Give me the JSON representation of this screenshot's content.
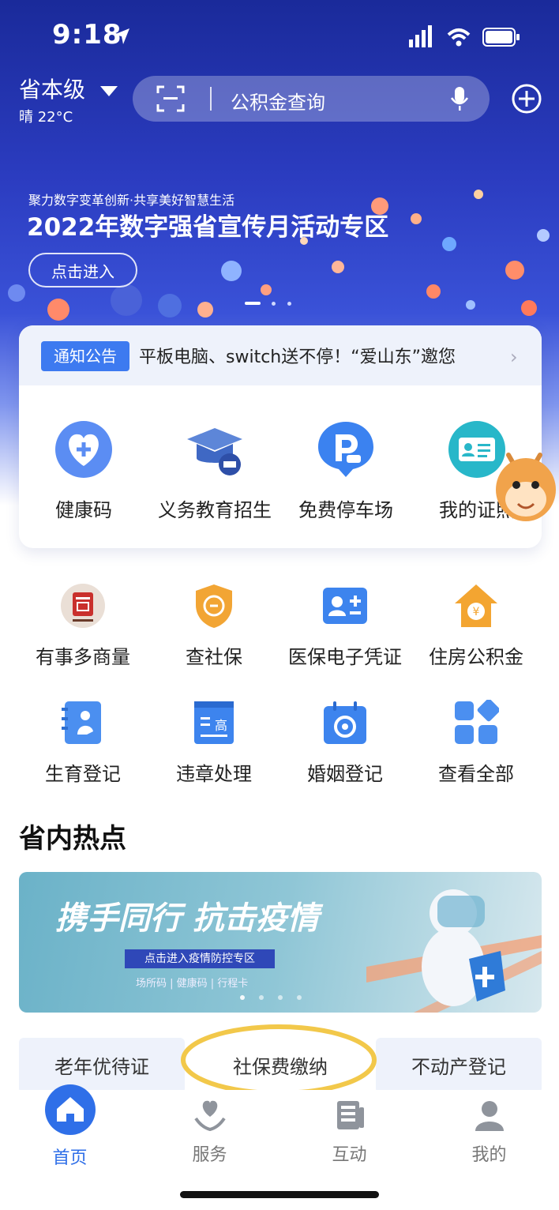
{
  "status_bar": {
    "time": "9:18"
  },
  "header": {
    "region": "省本级",
    "weather": "晴 22°C",
    "search_placeholder": "公积金查询"
  },
  "banner": {
    "subtitle": "聚力数字变革创新·共享美好智慧生活",
    "title": "2022年数字强省宣传月活动专区",
    "button": "点击进入"
  },
  "notice": {
    "tag": "通知公告",
    "text": "平板电脑、switch送不停！“爱山东”邀您"
  },
  "quick_items": [
    {
      "label": "健康码",
      "icon": "health-code-icon"
    },
    {
      "label": "义务教育招生",
      "icon": "education-cap-icon"
    },
    {
      "label": "免费停车场",
      "icon": "parking-icon"
    },
    {
      "label": "我的证照",
      "icon": "id-card-icon"
    }
  ],
  "services": [
    {
      "label": "有事多商量",
      "icon": "consult-seal-icon"
    },
    {
      "label": "查社保",
      "icon": "social-security-shield-icon"
    },
    {
      "label": "医保电子凭证",
      "icon": "medical-insurance-card-icon"
    },
    {
      "label": "住房公积金",
      "icon": "housing-fund-icon"
    },
    {
      "label": "生育登记",
      "icon": "birth-registration-icon"
    },
    {
      "label": "违章处理",
      "icon": "traffic-violation-icon"
    },
    {
      "label": "婚姻登记",
      "icon": "marriage-registration-icon"
    },
    {
      "label": "查看全部",
      "icon": "grid-all-icon"
    }
  ],
  "section_title": "省内热点",
  "hot_banner": {
    "title": "携手同行 抗击疫情",
    "button": "点击进入疫情防控专区",
    "subtitle": "场所码 | 健康码 | 行程卡"
  },
  "hot_tabs": [
    "老年优待证",
    "社保费缴纳",
    "不动产登记"
  ],
  "tabbar": [
    {
      "label": "首页",
      "icon": "home-icon",
      "active": true
    },
    {
      "label": "服务",
      "icon": "service-icon",
      "active": false
    },
    {
      "label": "互动",
      "icon": "interact-icon",
      "active": false
    },
    {
      "label": "我的",
      "icon": "profile-icon",
      "active": false
    }
  ],
  "colors": {
    "primary": "#3d7af0",
    "hero_dark": "#1a2a9a",
    "highlight_circle": "#f2c84a"
  }
}
